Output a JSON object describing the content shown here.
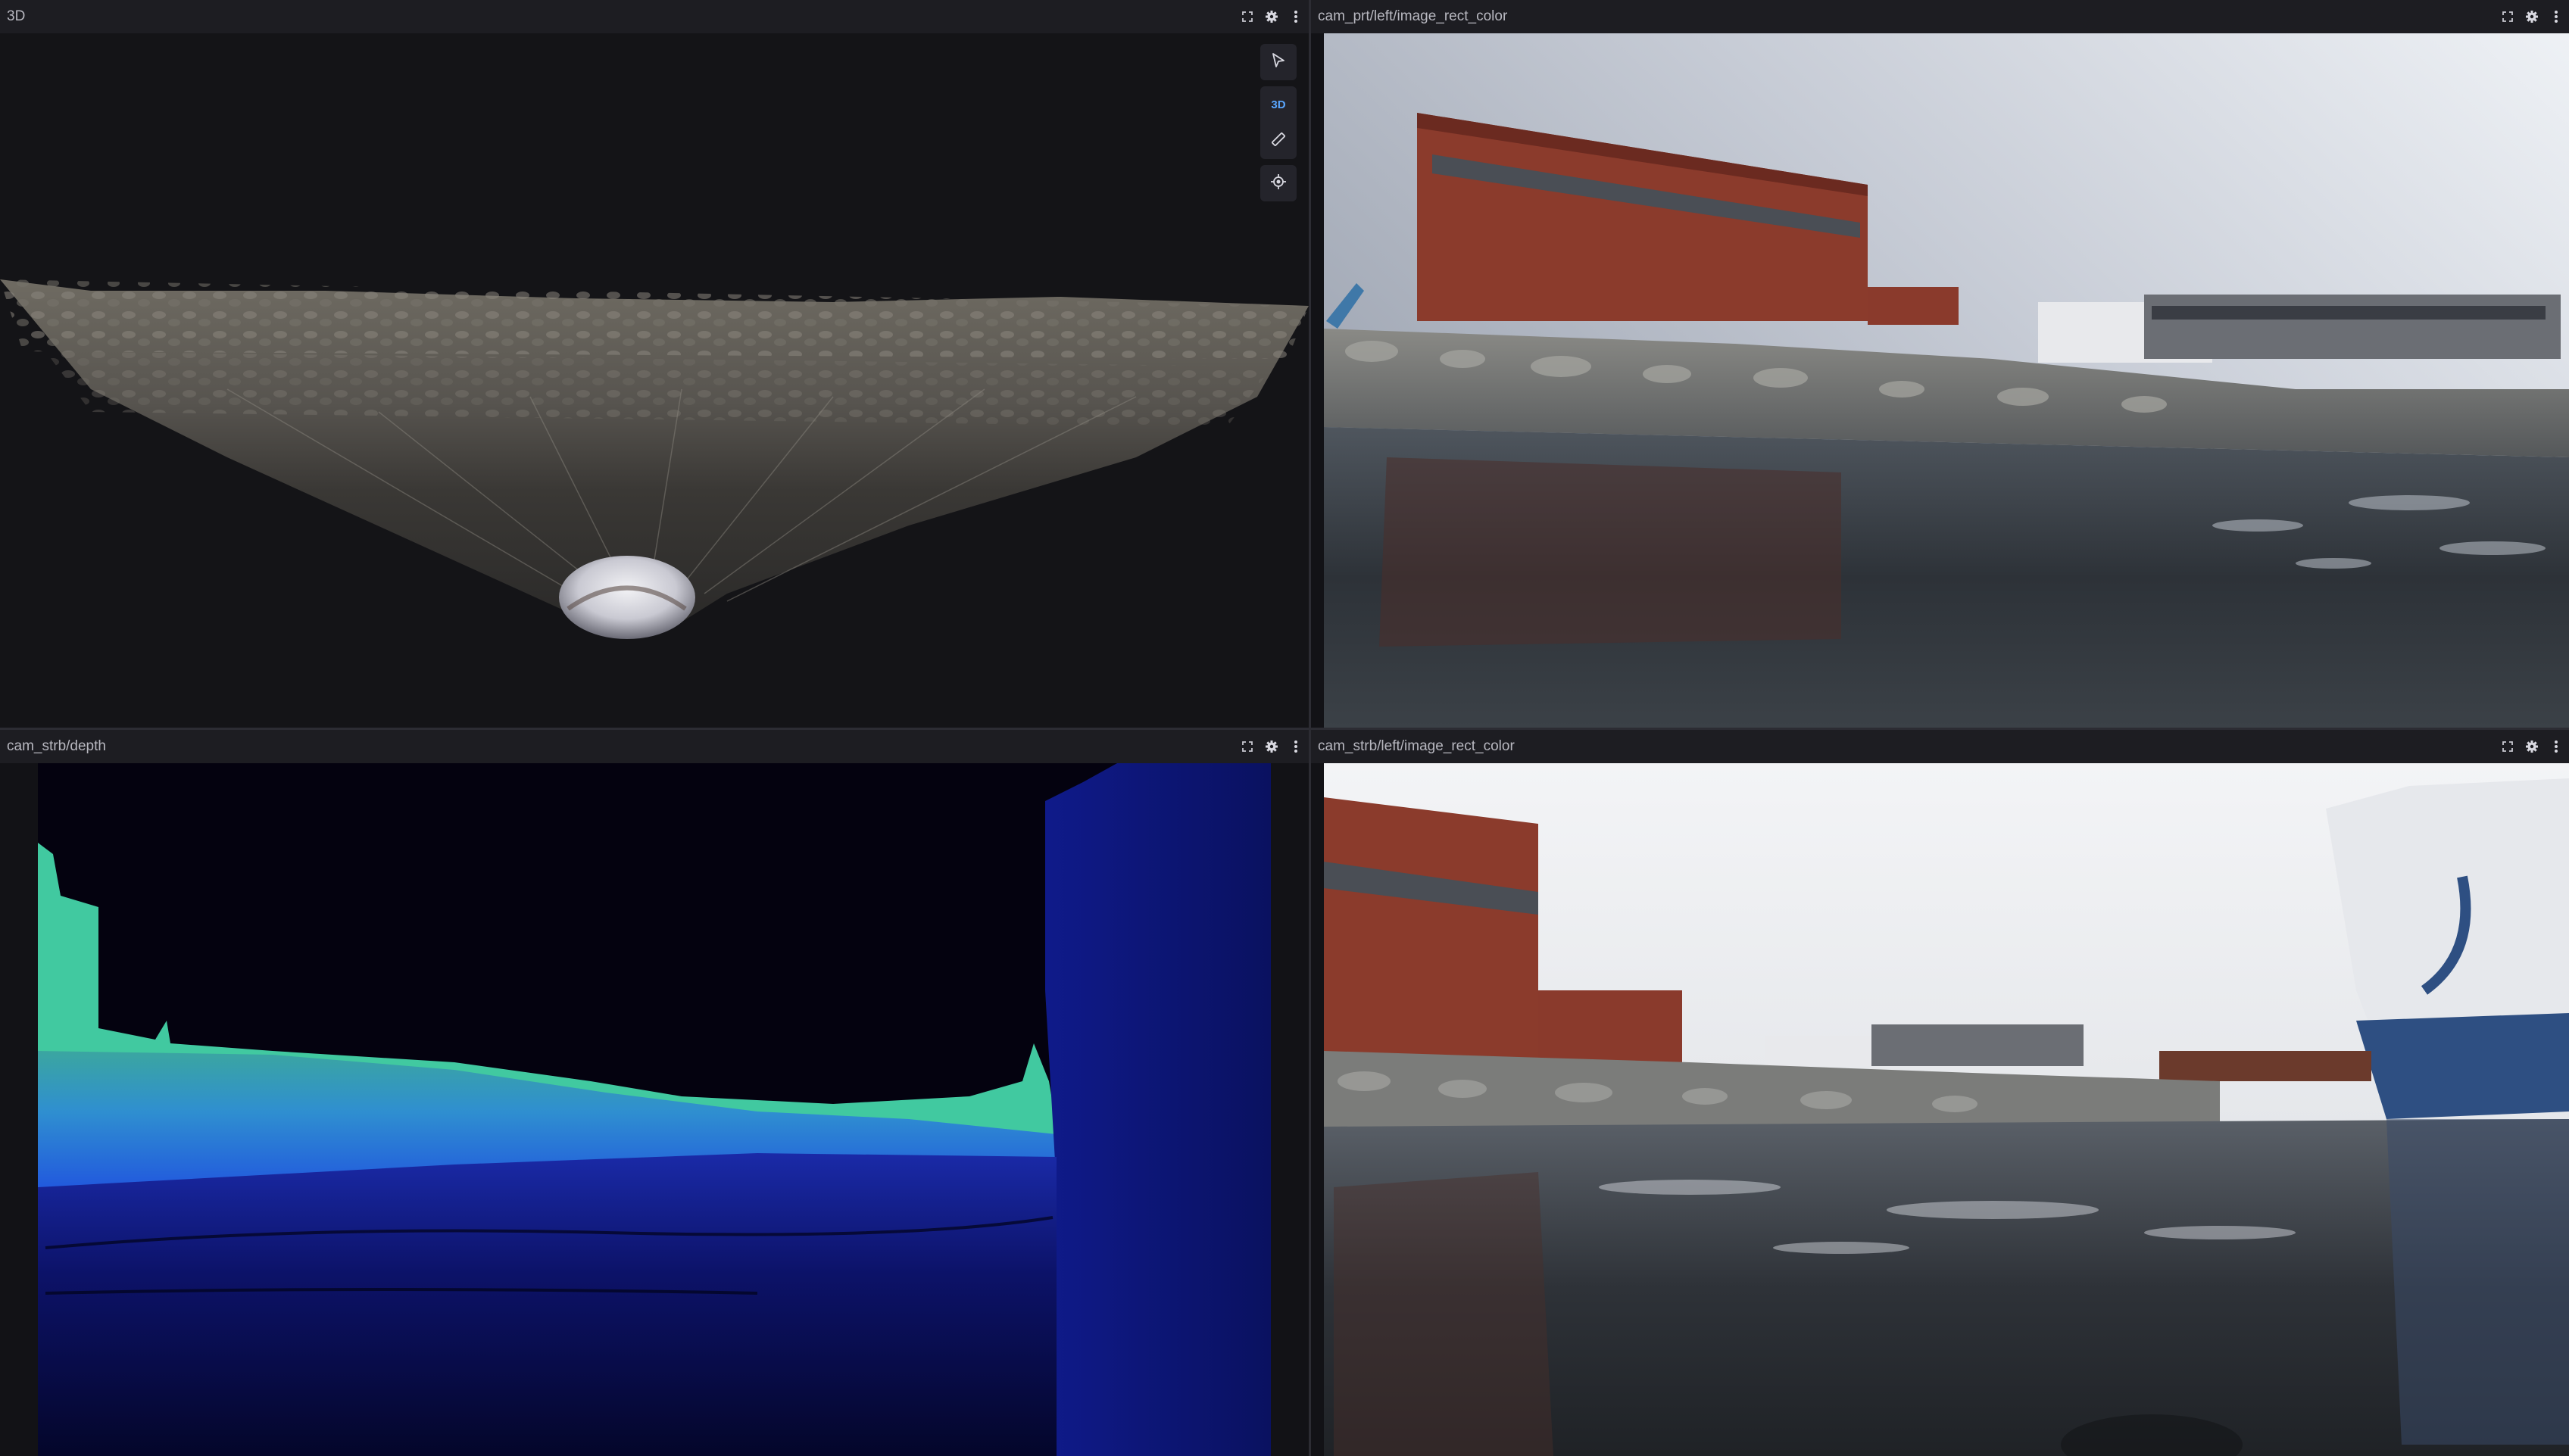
{
  "panels": {
    "three_d": {
      "title": "3D",
      "mode_label": "3D"
    },
    "cam_prt": {
      "title": "cam_prt/left/image_rect_color"
    },
    "depth": {
      "title": "cam_strb/depth"
    },
    "cam_strb": {
      "title": "cam_strb/left/image_rect_color"
    }
  },
  "icons": {
    "expand": "expand-icon",
    "settings": "gear-icon",
    "menu": "more-vertical-icon",
    "select": "cursor-icon",
    "measure": "ruler-icon",
    "locate": "crosshair-icon"
  },
  "colors": {
    "header_bg": "#1d1d22",
    "panel_bg": "#121216",
    "accent": "#5aa7ff"
  }
}
